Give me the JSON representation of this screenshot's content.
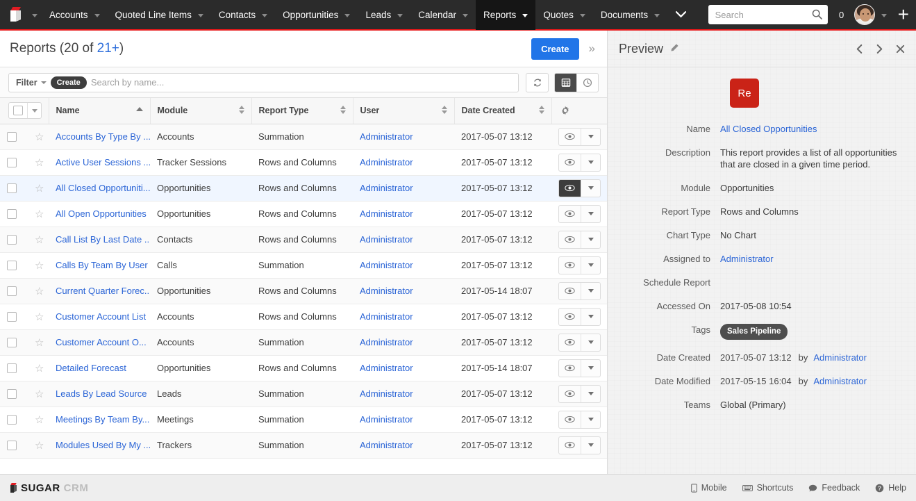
{
  "navbar": {
    "logo_icon": "sugarcrm-cube-logo",
    "items": [
      {
        "label": "Accounts",
        "caret": true,
        "active": false
      },
      {
        "label": "Quoted Line Items",
        "caret": true,
        "active": false
      },
      {
        "label": "Contacts",
        "caret": true,
        "active": false
      },
      {
        "label": "Opportunities",
        "caret": true,
        "active": false
      },
      {
        "label": "Leads",
        "caret": true,
        "active": false
      },
      {
        "label": "Calendar",
        "caret": true,
        "active": false
      },
      {
        "label": "Reports",
        "caret": true,
        "active": true
      },
      {
        "label": "Quotes",
        "caret": true,
        "active": false
      },
      {
        "label": "Documents",
        "caret": true,
        "active": false
      }
    ],
    "overflow_icon": "chevron-down-icon",
    "search_placeholder": "Search",
    "search_value": "",
    "search_icon": "search-icon",
    "notification_count": "0",
    "avatar_caret_icon": "chevron-down-icon",
    "plus_label": "+"
  },
  "list": {
    "title_prefix": "Reports (20 of ",
    "title_count": "21+",
    "title_suffix": ")",
    "create_button": "Create",
    "expand_icon": "double-chevron-right-icon",
    "filter_label": "Filter",
    "filter_create_pill": "Create",
    "search_placeholder": "Search by name...",
    "search_value": "",
    "refresh_icon": "refresh-icon",
    "grid_icon": "grid-view-icon",
    "clock_icon": "recently-viewed-icon",
    "gear_icon": "column-settings-gear-icon",
    "columns": [
      {
        "label": "Name",
        "sort": "asc"
      },
      {
        "label": "Module",
        "sort": "both"
      },
      {
        "label": "Report Type",
        "sort": "both"
      },
      {
        "label": "User",
        "sort": "both"
      },
      {
        "label": "Date Created",
        "sort": "both"
      }
    ],
    "rows": [
      {
        "name": "Accounts By Type By ...",
        "module": "Accounts",
        "report_type": "Summation",
        "user": "Administrator",
        "date_created": "2017-05-07 13:12",
        "selected": false
      },
      {
        "name": "Active User Sessions ...",
        "module": "Tracker Sessions",
        "report_type": "Rows and Columns",
        "user": "Administrator",
        "date_created": "2017-05-07 13:12",
        "selected": false
      },
      {
        "name": "All Closed Opportuniti...",
        "module": "Opportunities",
        "report_type": "Rows and Columns",
        "user": "Administrator",
        "date_created": "2017-05-07 13:12",
        "selected": true
      },
      {
        "name": "All Open Opportunities",
        "module": "Opportunities",
        "report_type": "Rows and Columns",
        "user": "Administrator",
        "date_created": "2017-05-07 13:12",
        "selected": false
      },
      {
        "name": "Call List By Last Date ...",
        "module": "Contacts",
        "report_type": "Rows and Columns",
        "user": "Administrator",
        "date_created": "2017-05-07 13:12",
        "selected": false
      },
      {
        "name": "Calls By Team By User",
        "module": "Calls",
        "report_type": "Summation",
        "user": "Administrator",
        "date_created": "2017-05-07 13:12",
        "selected": false
      },
      {
        "name": "Current Quarter Forec...",
        "module": "Opportunities",
        "report_type": "Rows and Columns",
        "user": "Administrator",
        "date_created": "2017-05-14 18:07",
        "selected": false
      },
      {
        "name": "Customer Account List",
        "module": "Accounts",
        "report_type": "Rows and Columns",
        "user": "Administrator",
        "date_created": "2017-05-07 13:12",
        "selected": false
      },
      {
        "name": "Customer Account O...",
        "module": "Accounts",
        "report_type": "Summation",
        "user": "Administrator",
        "date_created": "2017-05-07 13:12",
        "selected": false
      },
      {
        "name": "Detailed Forecast",
        "module": "Opportunities",
        "report_type": "Rows and Columns",
        "user": "Administrator",
        "date_created": "2017-05-14 18:07",
        "selected": false
      },
      {
        "name": "Leads By Lead Source",
        "module": "Leads",
        "report_type": "Summation",
        "user": "Administrator",
        "date_created": "2017-05-07 13:12",
        "selected": false
      },
      {
        "name": "Meetings By Team By...",
        "module": "Meetings",
        "report_type": "Summation",
        "user": "Administrator",
        "date_created": "2017-05-07 13:12",
        "selected": false
      },
      {
        "name": "Modules Used By My ...",
        "module": "Trackers",
        "report_type": "Summation",
        "user": "Administrator",
        "date_created": "2017-05-07 13:12",
        "selected": false
      }
    ]
  },
  "preview": {
    "title": "Preview",
    "edit_icon": "pencil-icon",
    "prev_icon": "chevron-left-icon",
    "next_icon": "chevron-right-icon",
    "close_icon": "close-icon",
    "record_icon_text": "Re",
    "record_icon_color": "#ca2317",
    "fields": [
      {
        "label": "Name",
        "value": "All Closed Opportunities",
        "type": "link"
      },
      {
        "label": "Description",
        "value": "This report provides a list of all opportunities that are closed in a given time period.",
        "type": "text"
      },
      {
        "label": "Module",
        "value": "Opportunities",
        "type": "text"
      },
      {
        "label": "Report Type",
        "value": "Rows and Columns",
        "type": "text"
      },
      {
        "label": "Chart Type",
        "value": "No Chart",
        "type": "text"
      },
      {
        "label": "Assigned to",
        "value": "Administrator",
        "type": "link"
      },
      {
        "label": "Schedule Report",
        "value": "",
        "type": "text"
      },
      {
        "label": "Accessed On",
        "value": "2017-05-08 10:54",
        "type": "text"
      },
      {
        "label": "Tags",
        "value": "Sales Pipeline",
        "type": "tag"
      },
      {
        "label": "Date Created",
        "value": "2017-05-07 13:12",
        "by": "by",
        "by_user": "Administrator",
        "type": "byline"
      },
      {
        "label": "Date Modified",
        "value": "2017-05-15 16:04",
        "by": "by",
        "by_user": "Administrator",
        "type": "byline"
      },
      {
        "label": "Teams",
        "value": "Global (Primary)",
        "type": "text"
      }
    ]
  },
  "footer": {
    "brand_sugar": "SUGAR",
    "brand_crm": "CRM",
    "links": [
      {
        "label": "Mobile",
        "icon": "mobile-phone-icon"
      },
      {
        "label": "Shortcuts",
        "icon": "keyboard-icon"
      },
      {
        "label": "Feedback",
        "icon": "speech-bubble-icon"
      },
      {
        "label": "Help",
        "icon": "question-circle-icon"
      }
    ]
  },
  "colors": {
    "nav_bg": "#2b2b2b",
    "accent_red": "#e61718",
    "link_blue": "#2a64d6",
    "button_blue": "#2175e8",
    "record_red": "#ca2317"
  }
}
